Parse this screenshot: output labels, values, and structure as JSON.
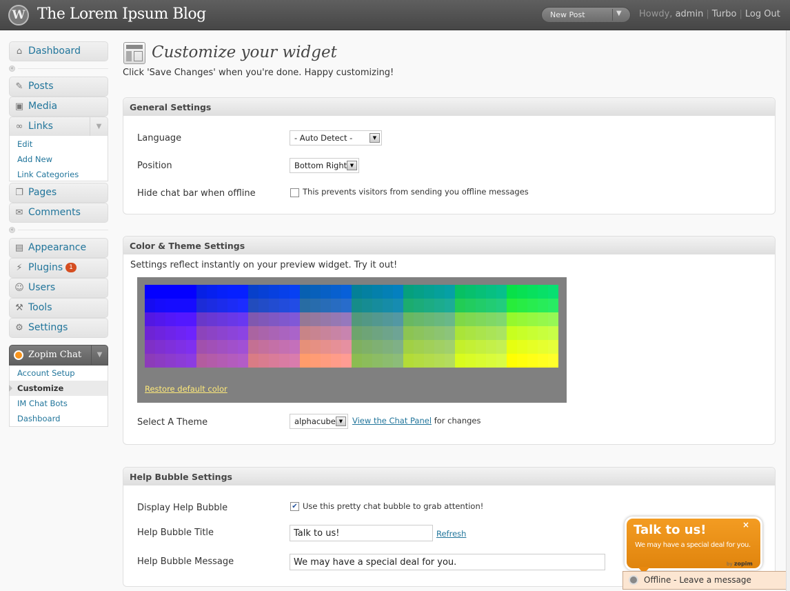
{
  "header": {
    "site_title": "The Lorem Ipsum Blog",
    "new_post": "New Post",
    "howdy": "Howdy,",
    "user": "admin",
    "turbo": "Turbo",
    "logout": "Log Out"
  },
  "sidebar": {
    "dashboard": "Dashboard",
    "posts": "Posts",
    "media": "Media",
    "links": "Links",
    "links_sub": [
      "Edit",
      "Add New",
      "Link Categories"
    ],
    "pages": "Pages",
    "comments": "Comments",
    "appearance": "Appearance",
    "plugins": "Plugins",
    "plugins_badge": "1",
    "users": "Users",
    "tools": "Tools",
    "settings": "Settings",
    "zopim": "Zopim Chat",
    "zopim_sub": [
      "Account Setup",
      "Customize",
      "IM Chat Bots",
      "Dashboard"
    ]
  },
  "main": {
    "title": "Customize your widget",
    "intro": "Click 'Save Changes' when you're done. Happy customizing!",
    "general": {
      "heading": "General Settings",
      "language_label": "Language",
      "language_value": "- Auto Detect -",
      "position_label": "Position",
      "position_value": "Bottom Right",
      "hide_label": "Hide chat bar when offline",
      "hide_text": "This prevents visitors from sending you offline messages",
      "hide_checked": false
    },
    "color": {
      "heading": "Color & Theme Settings",
      "note": "Settings reflect instantly on your preview widget. Try it out!",
      "restore": "Restore default color",
      "theme_label": "Select A Theme",
      "theme_value": "alphacube",
      "view_link": "View the Chat Panel",
      "view_suffix": "for changes"
    },
    "bubble": {
      "heading": "Help Bubble Settings",
      "display_label": "Display Help Bubble",
      "display_text": "Use this pretty chat bubble to grab attention!",
      "display_checked": true,
      "title_label": "Help Bubble Title",
      "title_value": "Talk to us!",
      "refresh": "Refresh",
      "message_label": "Help Bubble Message",
      "message_value": "We may have a special deal for you."
    }
  },
  "widget": {
    "bubble_title": "Talk to us!",
    "bubble_message": "We may have a special deal for you.",
    "close": "×",
    "by": "by",
    "brand": "zopim",
    "status": "Offline - Leave a message"
  },
  "colors": {
    "header_bg": "#464646",
    "link": "#21759b",
    "bubble_orange": "#f39c22",
    "palette_bg": "#808080",
    "restore_link": "#ffea7a"
  },
  "icons": {
    "dashboard": "home-icon",
    "posts": "pin-icon",
    "media": "media-icon",
    "links": "link-icon",
    "pages": "pages-icon",
    "comments": "comments-icon",
    "appearance": "appearance-icon",
    "plugins": "plugin-icon",
    "users": "users-icon",
    "tools": "tools-icon",
    "settings": "settings-icon"
  }
}
